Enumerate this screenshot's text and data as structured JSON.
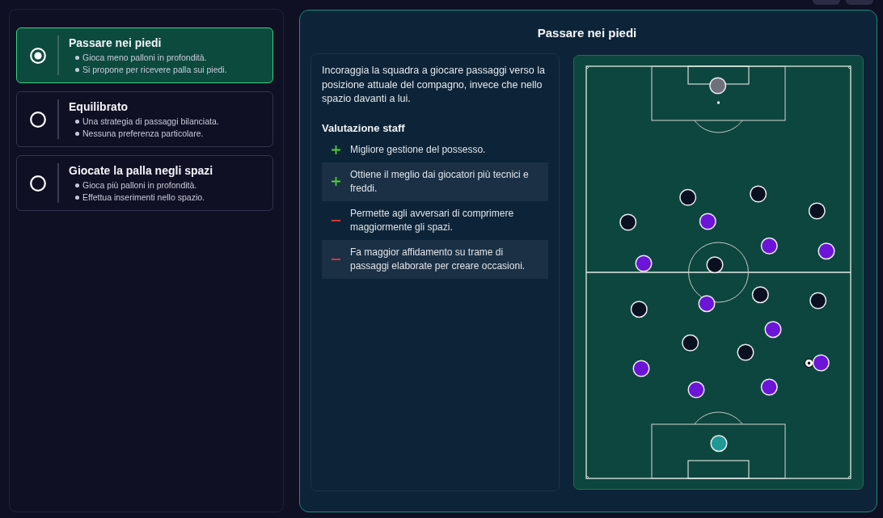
{
  "options": [
    {
      "title": "Passare nei piedi",
      "selected": true,
      "bullets": [
        "Gioca meno palloni in profondità.",
        "Si propone per ricevere palla sui piedi."
      ]
    },
    {
      "title": "Equilibrato",
      "selected": false,
      "bullets": [
        "Una strategia di passaggi bilanciata.",
        "Nessuna preferenza particolare."
      ]
    },
    {
      "title": "Giocate la palla negli spazi",
      "selected": false,
      "bullets": [
        "Gioca più palloni in profondità.",
        "Effettua inserimenti nello spazio."
      ]
    }
  ],
  "detail": {
    "title": "Passare nei piedi",
    "description": "Incoraggia la squadra a giocare passaggi verso la posizione attuale del compagno, invece che nello spazio davanti a lui.",
    "staff_heading": "Valutazione staff",
    "staff_items": [
      {
        "kind": "pro",
        "text": "Migliore gestione del possesso."
      },
      {
        "kind": "pro",
        "text": "Ottiene il meglio dai giocatori più tecnici e freddi."
      },
      {
        "kind": "con",
        "text": "Permette agli avversari di comprimere maggiormente gli spazi."
      },
      {
        "kind": "con",
        "text": "Fa maggior affidamento su trame di passaggi elaborate per creare occasioni."
      }
    ]
  }
}
